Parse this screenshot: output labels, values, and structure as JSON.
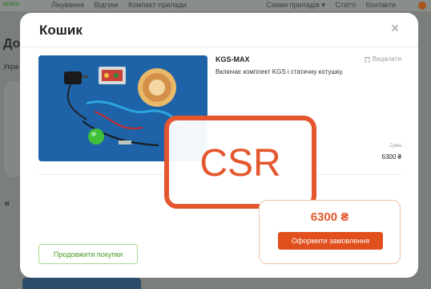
{
  "background": {
    "logo": "ᴮᴱᴿᴱᴳ",
    "nav_items": [
      "Лікування",
      "Відгуки",
      "Компакт-прилади"
    ],
    "nav_items_right": [
      "Схеми приладів ▾",
      "Статті",
      "Контакти"
    ],
    "heading": "До",
    "sub_label": "Укра",
    "side_label": "и"
  },
  "modal": {
    "title": "Кошик",
    "close_label": "×",
    "item": {
      "name": "KGS-MAX",
      "description": "Включає комплект KGS і статичну котушку.",
      "remove_label": "Видалити",
      "sum_label": "Сума",
      "sum_value": "6300 ₴"
    },
    "watermark_text": "CSR",
    "total": "6300 ₴",
    "order_button": "Оформити замовлення",
    "continue_button": "Продовжити покупки"
  },
  "colors": {
    "accent": "#e04f1c",
    "watermark": "#e4572e",
    "continue_green": "#4c9a2a"
  }
}
